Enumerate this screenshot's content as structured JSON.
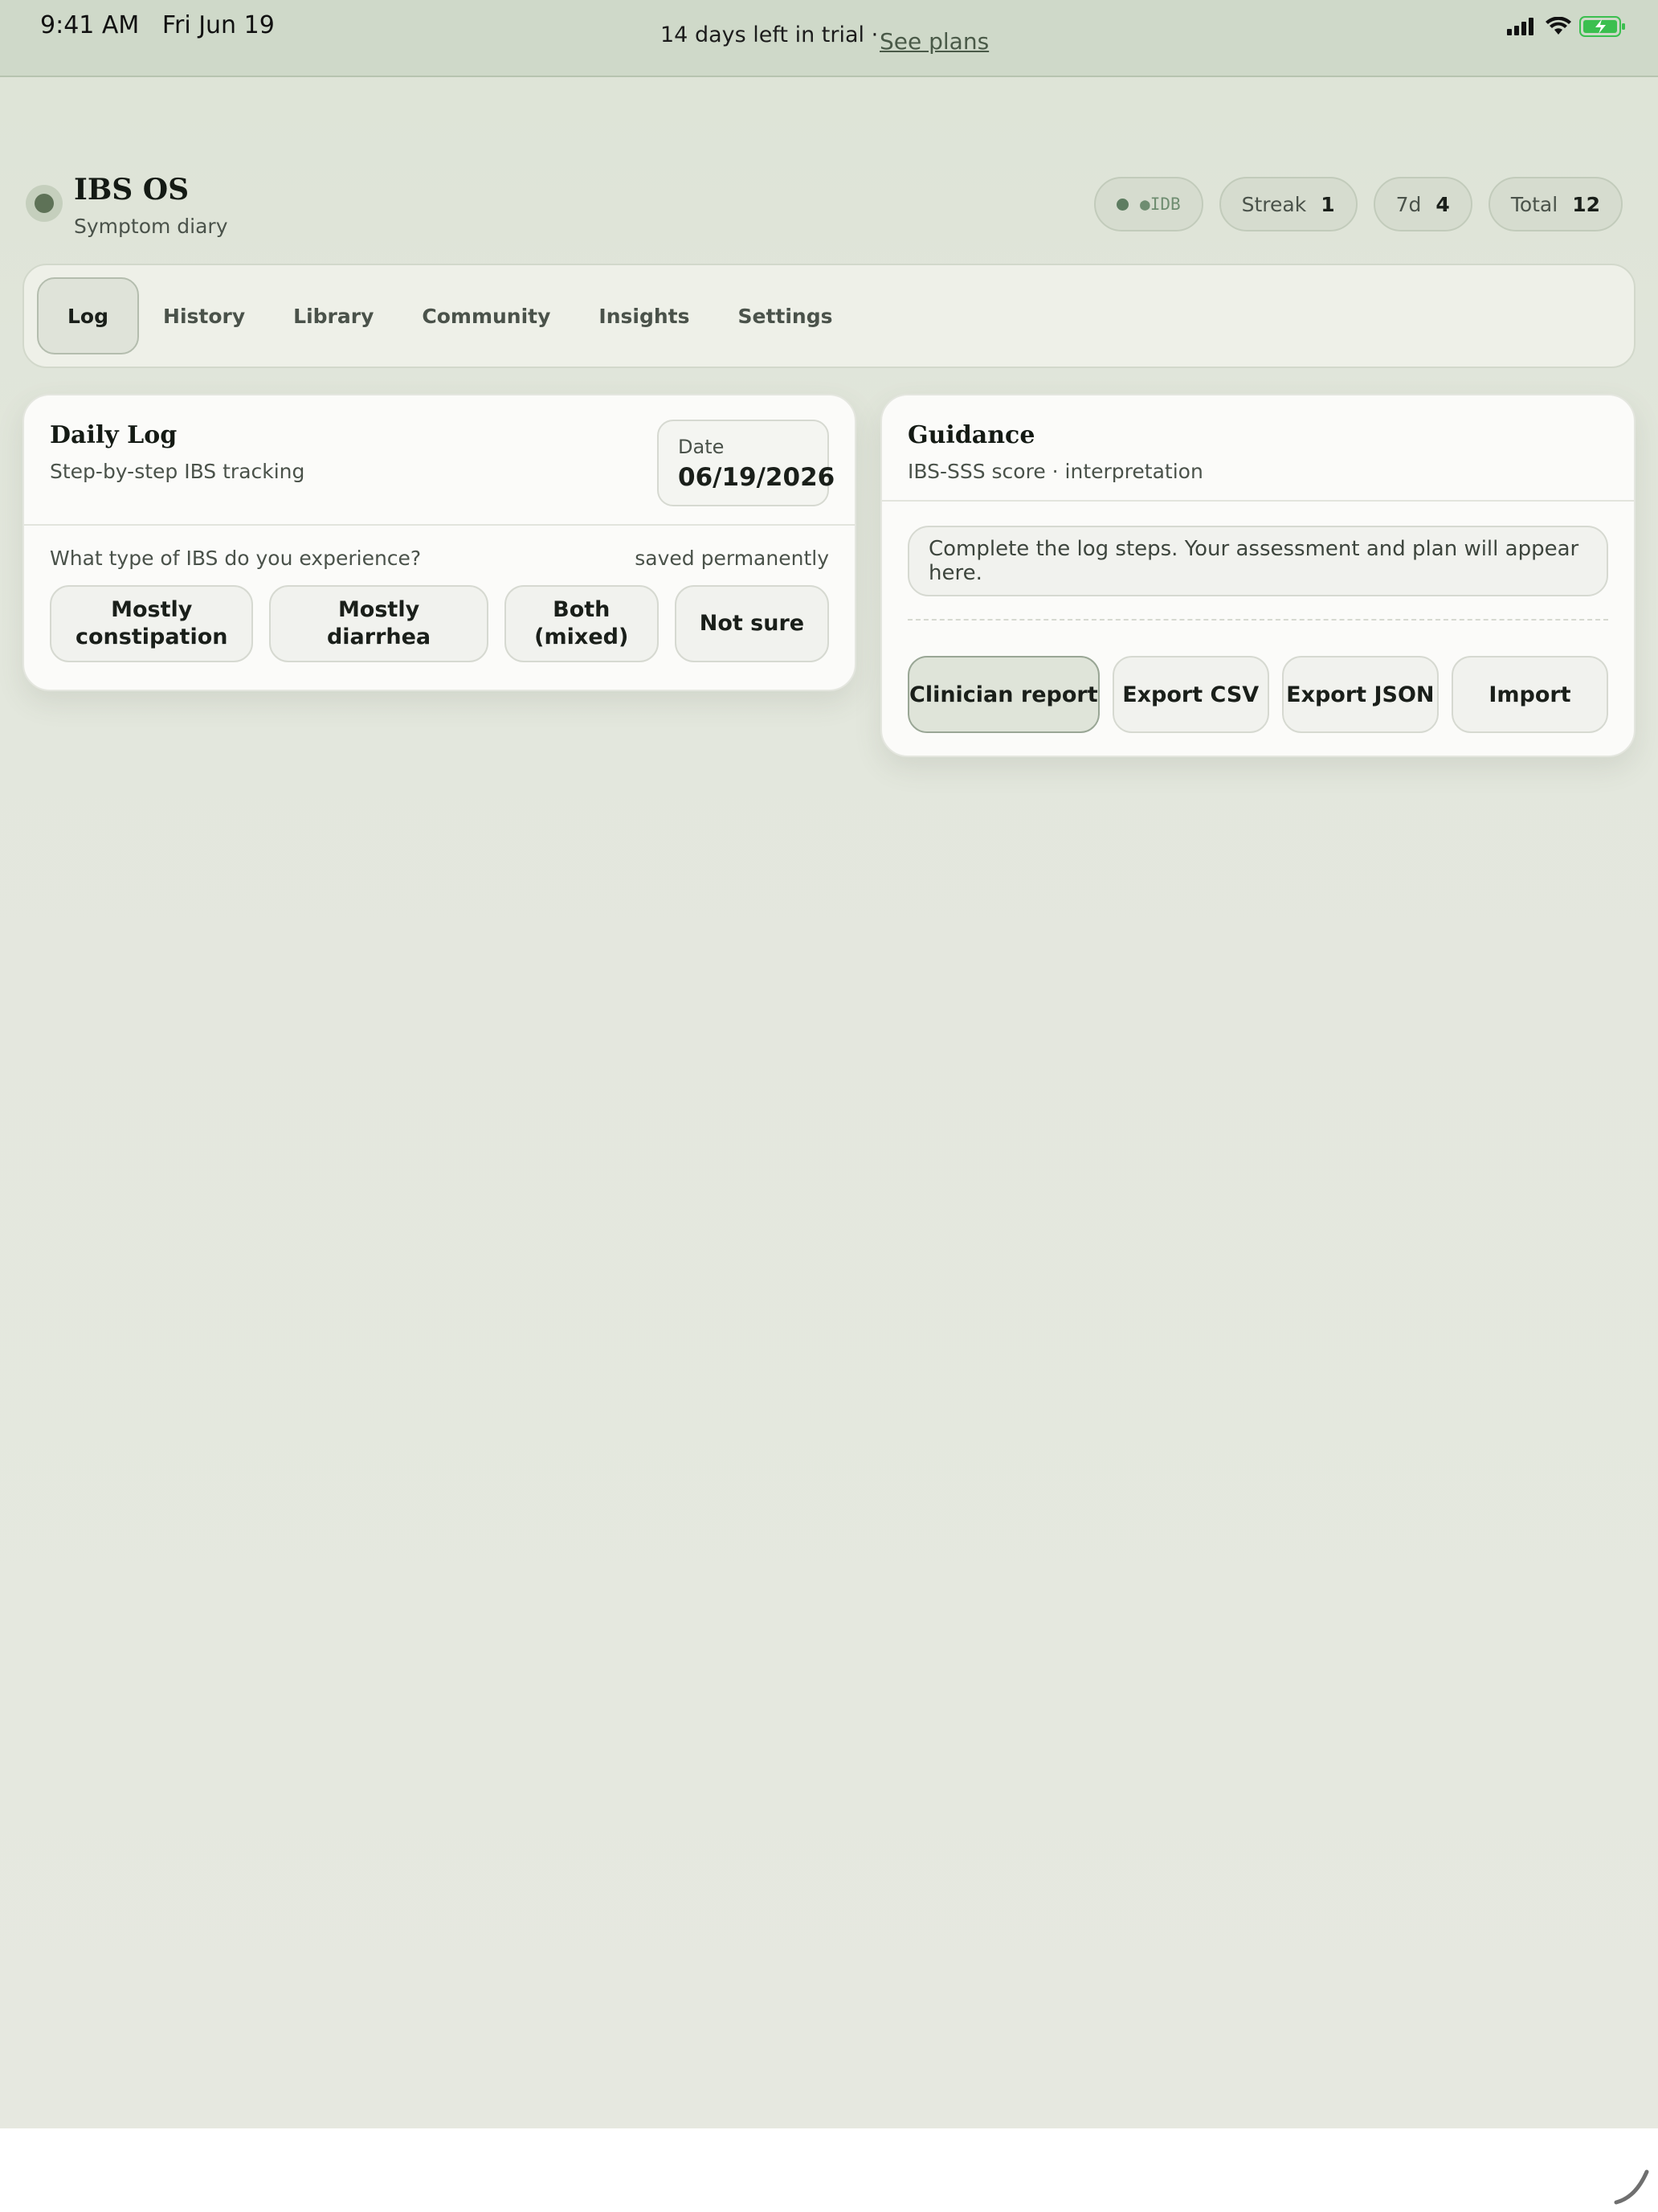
{
  "status_bar": {
    "time": "9:41 AM",
    "date": "Fri Jun 19",
    "trial_text": "14 days left in trial ·",
    "trial_link": "See plans"
  },
  "app": {
    "title": "IBS OS",
    "subtitle": "Symptom diary"
  },
  "chips": {
    "storage_label": "●IDB",
    "streak_label": "Streak",
    "streak_value": "1",
    "week_label": "7d",
    "week_value": "4",
    "total_label": "Total",
    "total_value": "12"
  },
  "nav": {
    "tabs": [
      {
        "label": "Log",
        "active": true
      },
      {
        "label": "History"
      },
      {
        "label": "Library"
      },
      {
        "label": "Community"
      },
      {
        "label": "Insights"
      },
      {
        "label": "Settings"
      }
    ]
  },
  "daily_log": {
    "title": "Daily Log",
    "subtitle": "Step-by-step IBS tracking",
    "date_label": "Date",
    "date_value": "06/19/2026",
    "question": "What type of IBS do you experience?",
    "question_note": "saved permanently",
    "options": [
      "Mostly constipation",
      "Mostly diarrhea",
      "Both (mixed)",
      "Not sure"
    ]
  },
  "guidance": {
    "title": "Guidance",
    "subtitle": "IBS-SSS score · interpretation",
    "message": "Complete the log steps. Your assessment and plan will appear here.",
    "actions": [
      "Clinician report",
      "Export CSV",
      "Export JSON",
      "Import"
    ]
  },
  "colors": {
    "accent": "#5e7257",
    "background": "#e4e7de",
    "battery": "#3bbf4f"
  },
  "icons": [
    "signal-icon",
    "wifi-icon",
    "battery-charging-icon",
    "resize-handle-icon"
  ]
}
